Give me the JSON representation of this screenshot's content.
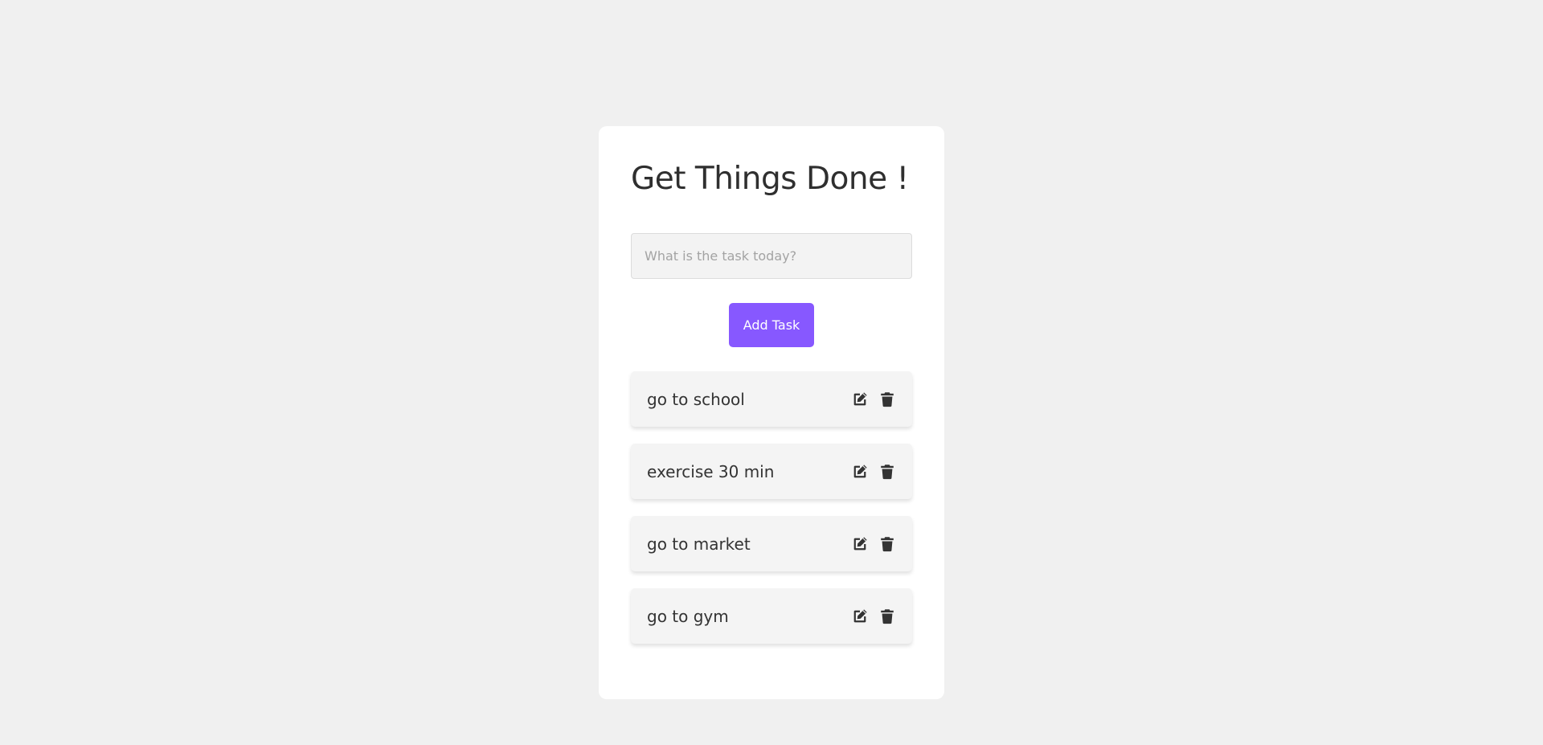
{
  "app": {
    "title": "Get Things Done !"
  },
  "input": {
    "placeholder": "What is the task today?",
    "value": ""
  },
  "add_button": {
    "label": "Add Task"
  },
  "tasks": [
    {
      "text": "go to school",
      "edit_icon": "edit-icon",
      "delete_icon": "trash-icon"
    },
    {
      "text": "exercise 30 min",
      "edit_icon": "edit-icon",
      "delete_icon": "trash-icon"
    },
    {
      "text": "go to market",
      "edit_icon": "edit-icon",
      "delete_icon": "trash-icon"
    },
    {
      "text": "go to gym",
      "edit_icon": "edit-icon",
      "delete_icon": "trash-icon"
    }
  ],
  "colors": {
    "background": "#f0f0f0",
    "card": "#ffffff",
    "accent": "#8758ff",
    "task_bg": "#f4f4f4",
    "text": "#333333"
  }
}
